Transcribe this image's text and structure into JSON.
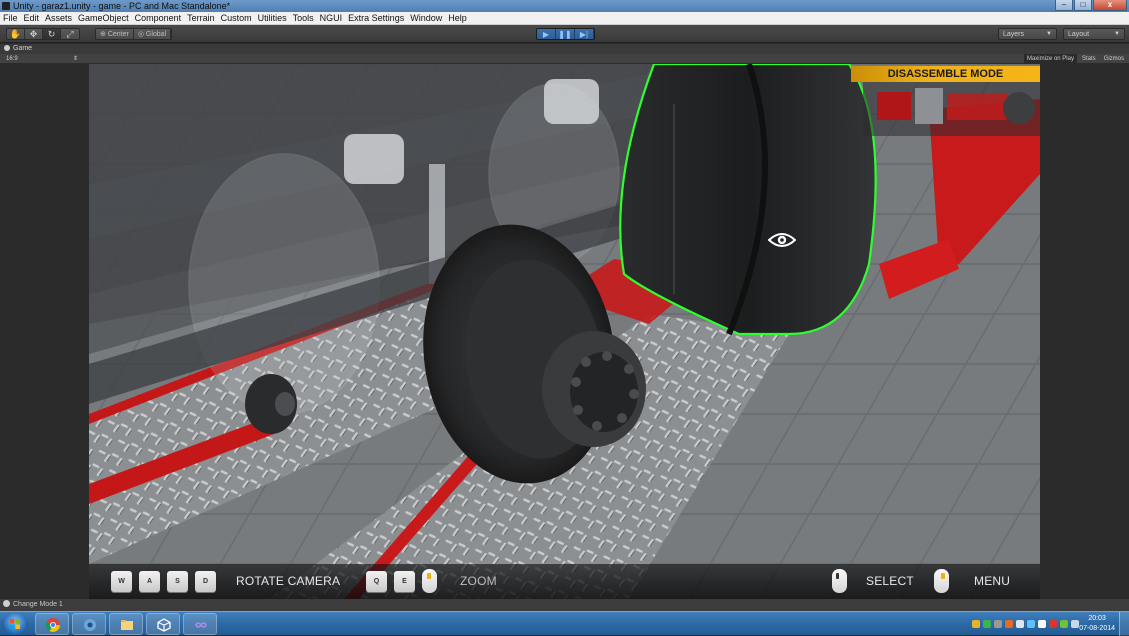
{
  "window": {
    "title": "Unity - garaz1.unity - game - PC and Mac Standalone*",
    "controls": {
      "minimize": "–",
      "maximize": "□",
      "close": "x"
    }
  },
  "menu": [
    "File",
    "Edit",
    "Assets",
    "GameObject",
    "Component",
    "Terrain",
    "Custom",
    "Utilities",
    "Tools",
    "NGUI",
    "Extra Settings",
    "Window",
    "Help"
  ],
  "toolbar": {
    "tools": [
      {
        "icon": "hand-icon",
        "glyph": "✋"
      },
      {
        "icon": "move-icon",
        "glyph": "✥"
      },
      {
        "icon": "rotate-icon",
        "glyph": "↻"
      },
      {
        "icon": "scale-icon",
        "glyph": "⤢"
      }
    ],
    "pivot": "Center",
    "space": "Global",
    "play": {
      "play": "▶",
      "pause": "❚❚",
      "step": "▶|"
    },
    "layers": "Layers",
    "layout": "Layout"
  },
  "game_panel": {
    "tab": "Game",
    "aspect": "16:9",
    "options": [
      "Maximize on Play",
      "Stats",
      "Gizmos"
    ]
  },
  "hud": {
    "mode": "DISASSEMBLE MODE",
    "keys": [
      "W",
      "A",
      "S",
      "D"
    ],
    "rotate_label": "ROTATE CAMERA",
    "zoom_keys": [
      "Q",
      "E"
    ],
    "zoom_label": "ZOOM",
    "select_label": "SELECT",
    "menu_label": "MENU"
  },
  "status": {
    "message": "Change Mode 1"
  },
  "taskbar": {
    "apps": [
      "chrome-icon",
      "settings-icon",
      "folder-icon",
      "unity-icon",
      "visual-studio-icon"
    ],
    "time": "20:03",
    "date": "07-08-2014"
  },
  "colors": {
    "accent_orange": "#f0b21a",
    "ramp_red": "#d01a1a",
    "outline_green": "#2dff2d",
    "unity_play_blue": "#2b5a92"
  }
}
